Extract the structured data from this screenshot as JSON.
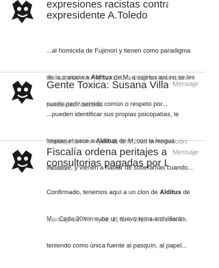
{
  "posts": [
    {
      "thumbnail_icon": "cartoon-avatar-icon",
      "title_lines": [
        "expresiones racistas contra",
        "expresidente A.Toledo"
      ],
      "badge": "",
      "snippet_lines": [
        "...al homicida de Fujimori y tienen como paradigma",
        "de la oratoria a Alditus de M, a sujetos así no se les",
        "puede pedir sentido común o respeto por..."
      ],
      "meta_lines": [
        "Mensaje de: Mr. Hyde, 11 Ene 2013 en la sección:",
        "Actualidad Nacional"
      ]
    },
    {
      "thumbnail_icon": "cartoon-avatar-icon",
      "title_lines": [
        "Gente Toxica: Susana Villaran?!"
      ],
      "badge": "Mensaje",
      "snippet_lines": [
        "...pueden identificar sus propias psicopatías, le",
        "limpian el saco a Alditus de M, con la lengua",
        "inclusive, y vienen a hablar de soberanías cuando..."
      ],
      "meta_lines": [
        "Mensaje de: Mr. Hyde, 11 Ene 2013 en la sección:",
        "Política"
      ]
    },
    {
      "thumbnail_icon": "cartoon-avatar-icon",
      "title_lines": [
        "Fiscalía ordena peritajes a",
        "consultorias pagadas por Lima"
      ],
      "badge": "Mensaje",
      "snippet_lines": [
        "Confirmado, tenemos aquí a un clon de Alditus de",
        "M... Cada 30min sube un nuevo tema antivillarán",
        "teniendo como única fuente al pasquín, al papel..."
      ],
      "meta_lines": [
        "Mensaje de: Mr. Hyde, 11 Ene 2013 en la sección:"
      ]
    }
  ],
  "highlight_term": "Alditus",
  "colors": {
    "title": "#2b2b2b",
    "meta": "#8a8a8a",
    "badge": "#9a9a9a",
    "divider": "#dcdcdc"
  }
}
